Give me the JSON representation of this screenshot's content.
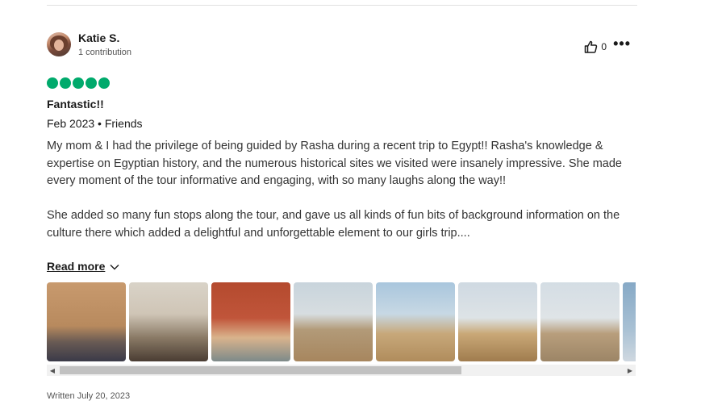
{
  "review": {
    "author": {
      "name": "Katie S.",
      "contributions": "1 contribution"
    },
    "helpful_count": "0",
    "rating": 5,
    "rating_color": "#00aa6c",
    "title": "Fantastic!!",
    "meta": "Feb 2023 • Friends",
    "paragraphs": [
      "My mom & I had the privilege of being guided by Rasha during a recent trip to Egypt!! Rasha's knowledge & expertise on Egyptian history, and the numerous historical sites we visited were insanely impressive. She made every moment of the tour informative and engaging, with so many laughs along the way!!",
      "She added so many fun stops along the tour, and gave us all kinds of fun bits of background information on the culture there which added a delightful and unforgettable element to our girls trip...."
    ],
    "read_more_label": "Read more",
    "photos": [
      {
        "name": "photo-temple-interior"
      },
      {
        "name": "photo-papyrus-shop"
      },
      {
        "name": "photo-egyptian-museum"
      },
      {
        "name": "photo-pyramids-crowd"
      },
      {
        "name": "photo-pyramids-posing"
      },
      {
        "name": "photo-camel-riders"
      },
      {
        "name": "photo-tour-group"
      },
      {
        "name": "photo-cut-off"
      }
    ],
    "written_date": "Written July 20, 2023"
  },
  "icons": {
    "helpful": "thumbs-up-icon",
    "more": "more-options-icon",
    "read_more": "chevron-down-icon",
    "scroll_left": "scroll-left-arrow-icon",
    "scroll_right": "scroll-right-arrow-icon"
  }
}
